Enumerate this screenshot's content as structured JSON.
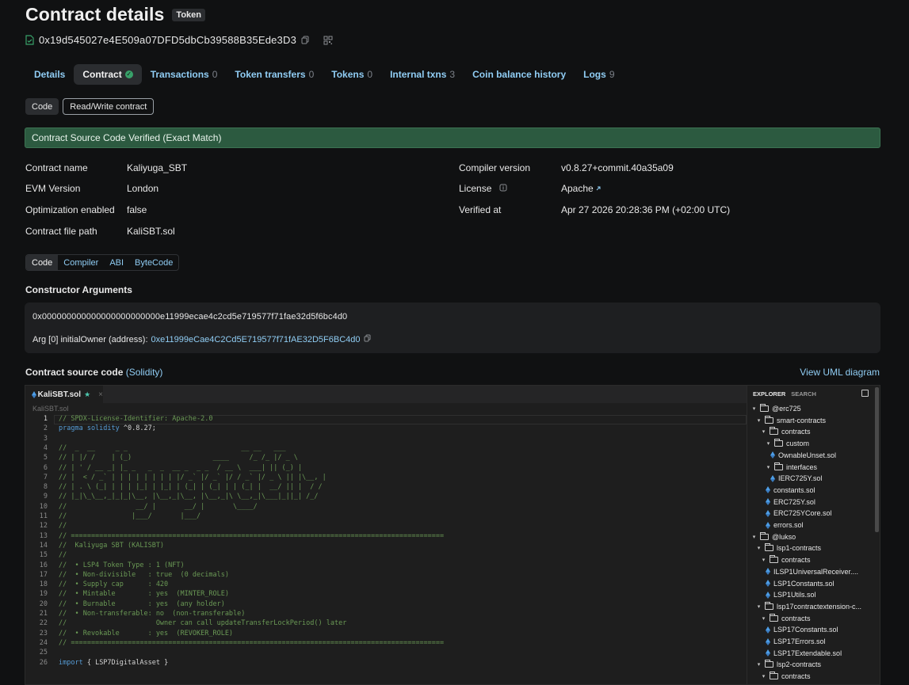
{
  "header": {
    "title": "Contract details",
    "badge": "Token",
    "address": "0x19d545027e4E509a07DFD5dbCb39588B35Ede3D3"
  },
  "tabs": [
    {
      "label": "Details",
      "count": ""
    },
    {
      "label": "Contract",
      "count": ""
    },
    {
      "label": "Transactions",
      "count": "0"
    },
    {
      "label": "Token transfers",
      "count": "0"
    },
    {
      "label": "Tokens",
      "count": "0"
    },
    {
      "label": "Internal txns",
      "count": "3"
    },
    {
      "label": "Coin balance history",
      "count": ""
    },
    {
      "label": "Logs",
      "count": "9"
    }
  ],
  "subtabs": {
    "code": "Code",
    "readwrite": "Read/Write contract"
  },
  "verified_banner": "Contract Source Code Verified (Exact Match)",
  "info": {
    "contract_name_label": "Contract name",
    "contract_name": "Kaliyuga_SBT",
    "evm_label": "EVM Version",
    "evm": "London",
    "opt_label": "Optimization enabled",
    "opt": "false",
    "path_label": "Contract file path",
    "path": "KaliSBT.sol",
    "compiler_label": "Compiler version",
    "compiler": "v0.8.27+commit.40a35a09",
    "license_label": "License",
    "license": "Apache",
    "verified_label": "Verified at",
    "verified": "Apr 27 2026 20:28:36 PM (+02:00 UTC)"
  },
  "code_tabs": [
    "Code",
    "Compiler",
    "ABI",
    "ByteCode"
  ],
  "constructor": {
    "label": "Constructor Arguments",
    "hex": "0x000000000000000000000000e11999ecae4c2cd5e719577f71fae32d5f6bc4d0",
    "arg_label": "Arg [0] initialOwner (address):",
    "arg_value": "0xe11999eCae4C2Cd5E719577f71fAE32D5F6BC4d0"
  },
  "source": {
    "label": "Contract source code",
    "lang": "(Solidity)",
    "uml": "View UML diagram",
    "file_tab": "KaliSBT.sol",
    "breadcrumb": "KaliSBT.sol"
  },
  "code_lines": [
    {
      "n": "1",
      "t": "// SPDX-License-Identifier: Apache-2.0"
    },
    {
      "n": "2",
      "t": "pragma solidity ^0.8.27;"
    },
    {
      "n": "3",
      "t": ""
    },
    {
      "n": "4",
      "t": "//  _  __     _ _                            __ __   ___"
    },
    {
      "n": "5",
      "t": "// | |/ /    | (_)                    ____     /_ /_ |/ _ \\"
    },
    {
      "n": "6",
      "t": "// | ' / __ _| |_ _   _  _  __ _  _ _  / __ \\  ___| || (_) |"
    },
    {
      "n": "7",
      "t": "// |  < / _` | | | | | | | | |/ _` |/ _` |/ / _` |/ _ \\ || |\\__, |"
    },
    {
      "n": "8",
      "t": "// | . \\ (_| | | | |_| | |_| | (_| | (_| | | (_| |  __/ || |  / /"
    },
    {
      "n": "9",
      "t": "// |_|\\_\\__,_|_|_|\\__, |\\__,_|\\__, |\\__,_|\\ \\__,_|\\___|_||_| /_/"
    },
    {
      "n": "10",
      "t": "//                 __/ |       __/ |       \\____/"
    },
    {
      "n": "11",
      "t": "//                |___/       |___/"
    },
    {
      "n": "12",
      "t": "//"
    },
    {
      "n": "13",
      "t": "// ============================================================================================"
    },
    {
      "n": "14",
      "t": "//  Kaliyuga SBT (KALISBT)"
    },
    {
      "n": "15",
      "t": "//"
    },
    {
      "n": "16",
      "t": "//  • LSP4 Token Type : 1 (NFT)"
    },
    {
      "n": "17",
      "t": "//  • Non-divisible   : true  (0 decimals)"
    },
    {
      "n": "18",
      "t": "//  • Supply cap      : 420"
    },
    {
      "n": "19",
      "t": "//  • Mintable        : yes  (MINTER_ROLE)"
    },
    {
      "n": "20",
      "t": "//  • Burnable        : yes  (any holder)"
    },
    {
      "n": "21",
      "t": "//  • Non-transferable: no  (non-transferable)"
    },
    {
      "n": "22",
      "t": "//                      Owner can call updateTransferLockPeriod() later"
    },
    {
      "n": "23",
      "t": "//  • Revokable       : yes  (REVOKER_ROLE)"
    },
    {
      "n": "24",
      "t": "// ============================================================================================"
    },
    {
      "n": "25",
      "t": ""
    },
    {
      "n": "26",
      "t": "import { LSP7DigitalAsset }"
    }
  ],
  "explorer": {
    "tab_explorer": "EXPLORER",
    "tab_search": "SEARCH",
    "items": [
      {
        "label": "@erc725",
        "type": "folder",
        "depth": 0
      },
      {
        "label": "smart-contracts",
        "type": "folder",
        "depth": 1
      },
      {
        "label": "contracts",
        "type": "folder",
        "depth": 2
      },
      {
        "label": "custom",
        "type": "folder",
        "depth": 3
      },
      {
        "label": "OwnableUnset.sol",
        "type": "file",
        "depth": 4
      },
      {
        "label": "interfaces",
        "type": "folder",
        "depth": 3
      },
      {
        "label": "IERC725Y.sol",
        "type": "file",
        "depth": 4
      },
      {
        "label": "constants.sol",
        "type": "file",
        "depth": 3
      },
      {
        "label": "ERC725Y.sol",
        "type": "file",
        "depth": 3
      },
      {
        "label": "ERC725YCore.sol",
        "type": "file",
        "depth": 3
      },
      {
        "label": "errors.sol",
        "type": "file",
        "depth": 3
      },
      {
        "label": "@lukso",
        "type": "folder",
        "depth": 0
      },
      {
        "label": "lsp1-contracts",
        "type": "folder",
        "depth": 1
      },
      {
        "label": "contracts",
        "type": "folder",
        "depth": 2
      },
      {
        "label": "ILSP1UniversalReceiver....",
        "type": "file",
        "depth": 3
      },
      {
        "label": "LSP1Constants.sol",
        "type": "file",
        "depth": 3
      },
      {
        "label": "LSP1Utils.sol",
        "type": "file",
        "depth": 3
      },
      {
        "label": "lsp17contractextension-c...",
        "type": "folder",
        "depth": 1
      },
      {
        "label": "contracts",
        "type": "folder",
        "depth": 2
      },
      {
        "label": "LSP17Constants.sol",
        "type": "file",
        "depth": 3
      },
      {
        "label": "LSP17Errors.sol",
        "type": "file",
        "depth": 3
      },
      {
        "label": "LSP17Extendable.sol",
        "type": "file",
        "depth": 3
      },
      {
        "label": "lsp2-contracts",
        "type": "folder",
        "depth": 1
      },
      {
        "label": "contracts",
        "type": "folder",
        "depth": 2
      }
    ]
  },
  "icons": {
    "file": "file-check-icon",
    "copy": "copy-icon",
    "qr": "qr-code-icon",
    "info": "info-icon",
    "external": "external-link-icon"
  }
}
